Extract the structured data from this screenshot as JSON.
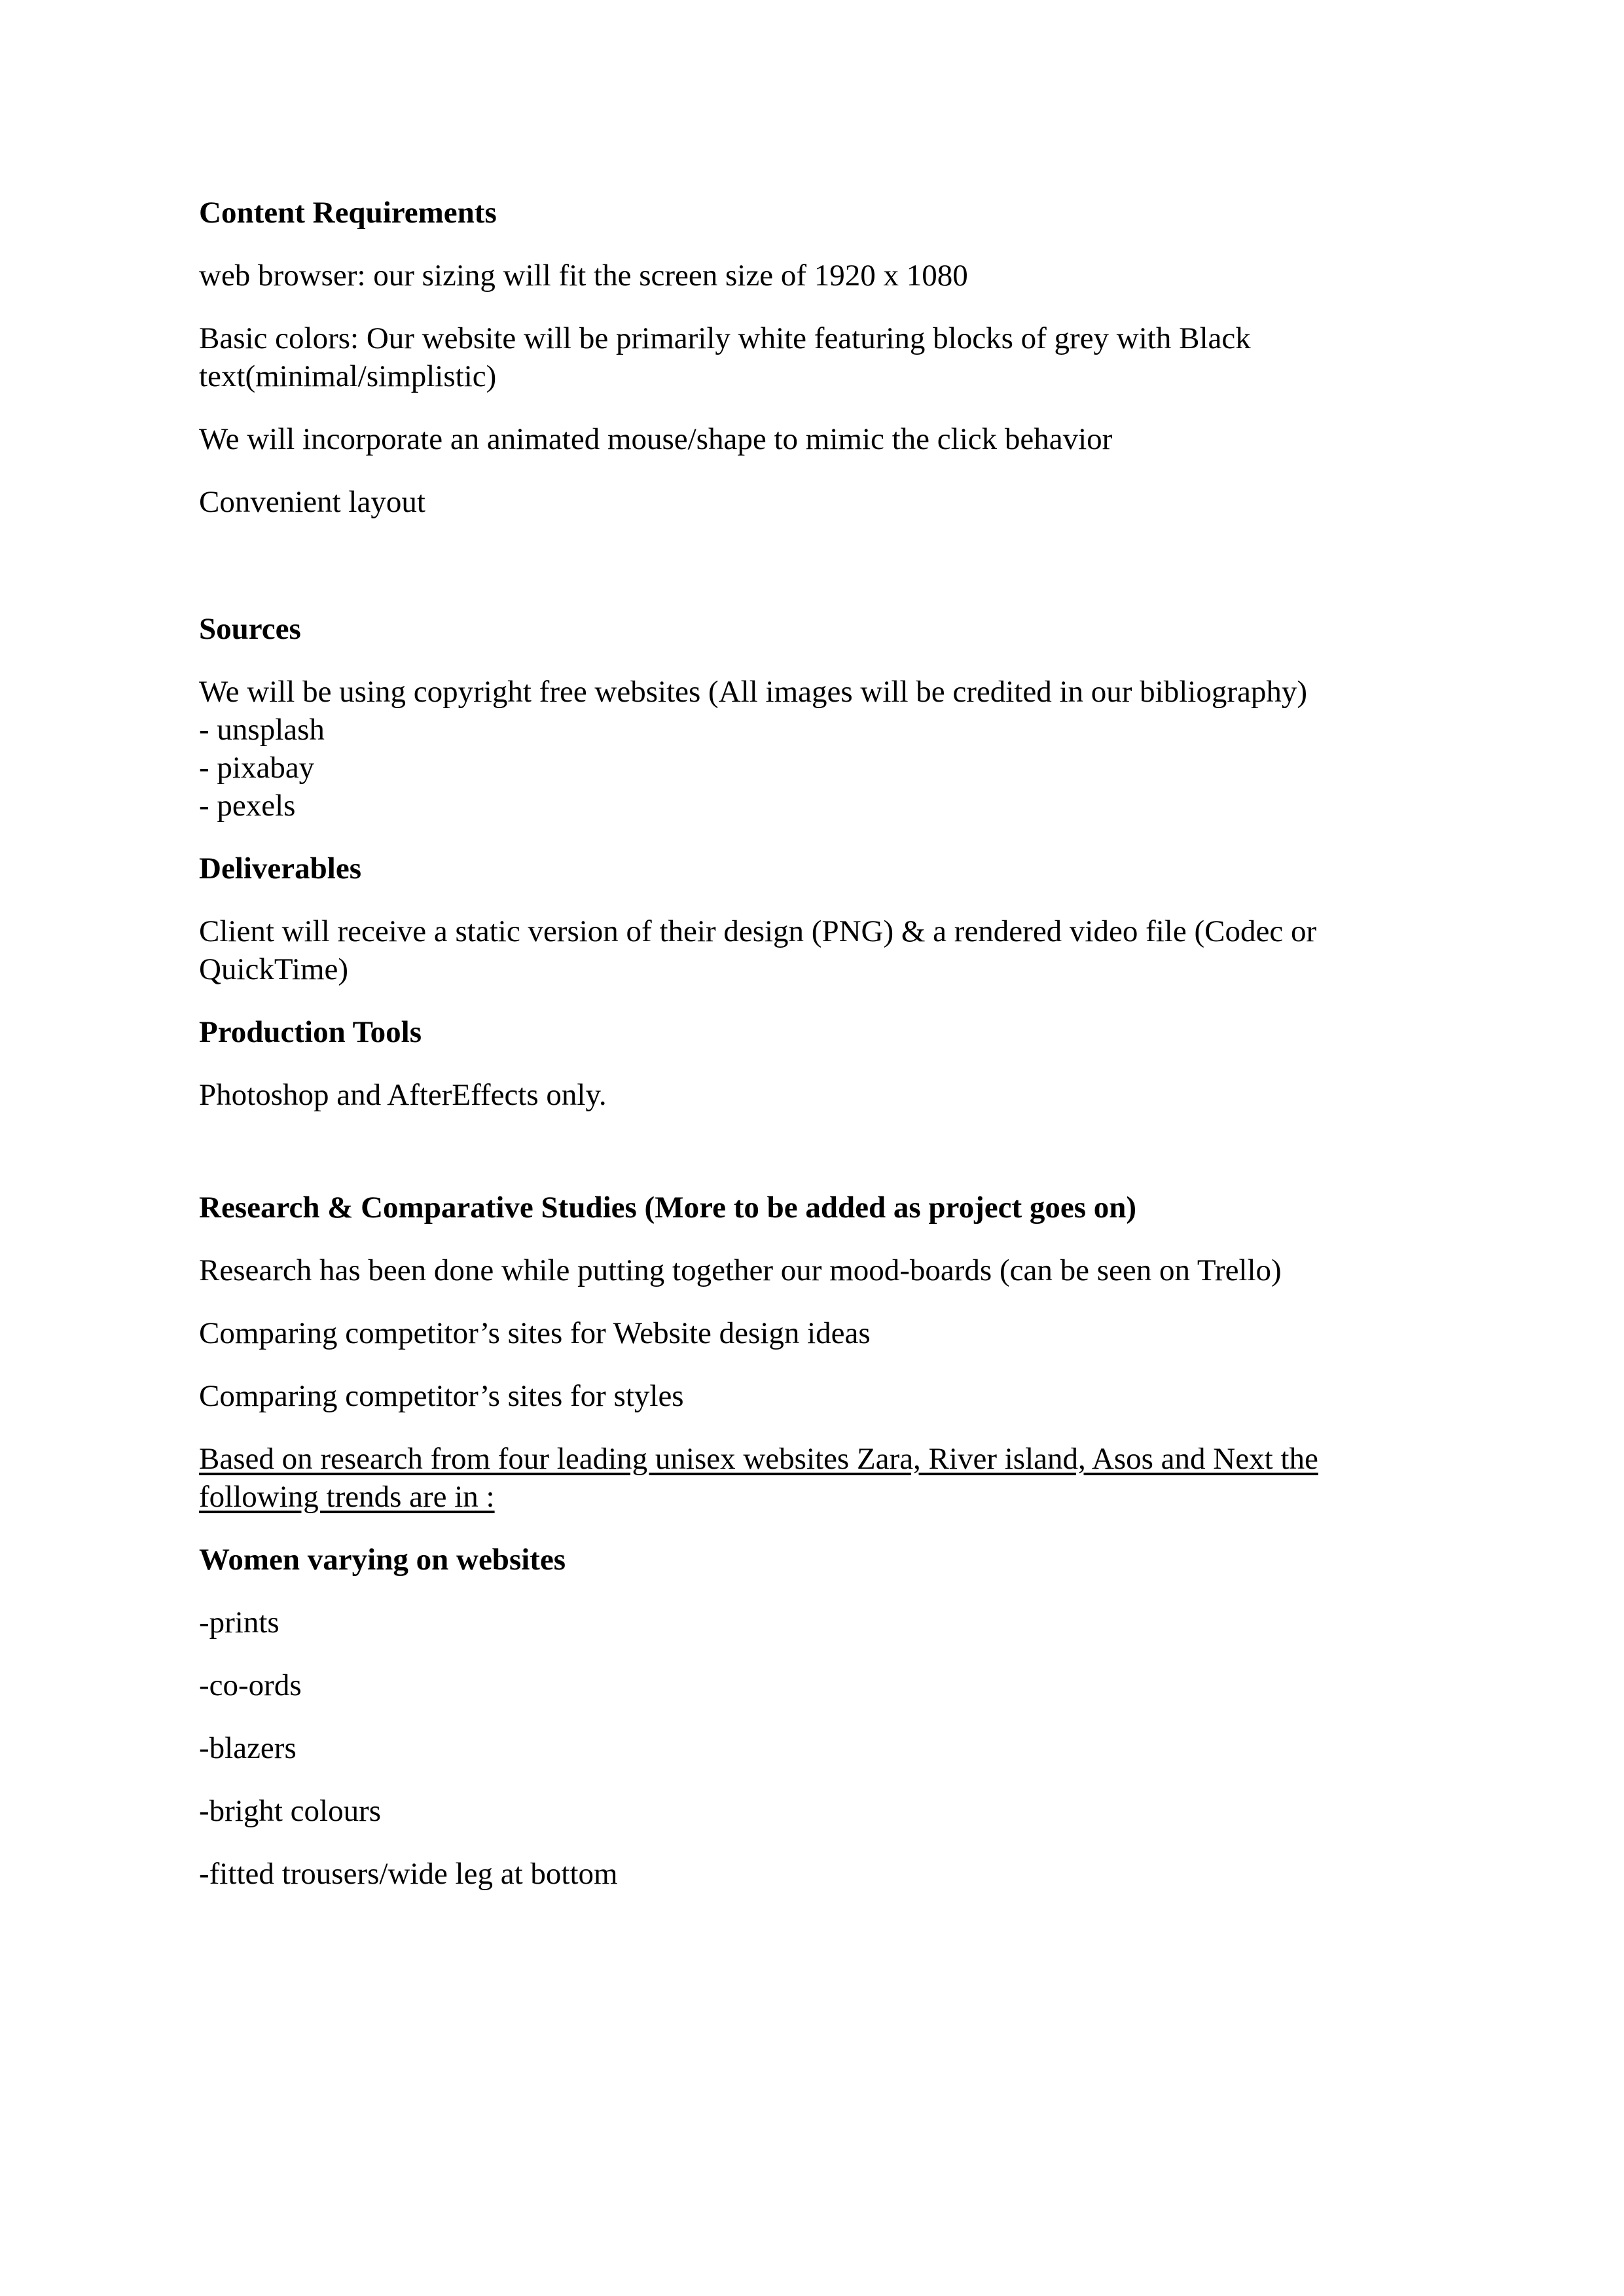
{
  "content_requirements": {
    "heading": "Content Requirements",
    "web_browser": "web browser: our sizing will fit the screen size of 1920 x 1080",
    "basic_colors": "Basic colors: Our website will be primarily white featuring blocks of grey with Black text(minimal/simplistic)",
    "animation": "We will incorporate an animated mouse/shape to mimic the click behavior",
    "layout": "Convenient layout"
  },
  "sources": {
    "heading": "Sources",
    "intro": "We will be using copyright free websites (All images will be credited in our bibliography)",
    "items": [
      "-  unsplash",
      "-  pixabay",
      "-  pexels"
    ]
  },
  "deliverables": {
    "heading": "Deliverables",
    "text": "Client will receive a static version of their design (PNG) & a rendered video file (Codec or QuickTime)"
  },
  "production_tools": {
    "heading": "Production Tools",
    "text": "Photoshop and AfterEffects only."
  },
  "research": {
    "heading": "Research & Comparative Studies (More to be added as project goes on)",
    "paragraphs": [
      "Research has been done while putting together our mood-boards (can be seen on Trello)",
      "Comparing competitor’s sites for Website design ideas",
      "Comparing competitor’s sites for styles"
    ],
    "trends_intro": "Based on research from four leading unisex websites Zara, River island, Asos and Next the following trends are in :"
  },
  "women_trends": {
    "heading": "Women varying on websites",
    "items": [
      "-prints",
      "-co-ords",
      "-blazers",
      "-bright colours",
      "-fitted trousers/wide leg at bottom"
    ]
  }
}
